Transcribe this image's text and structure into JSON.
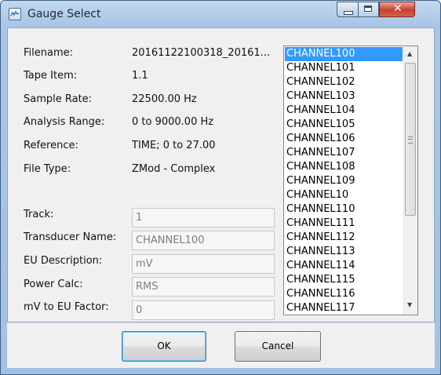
{
  "window": {
    "title": "Gauge Select",
    "close_glyph": "✕"
  },
  "info": {
    "filename_label": "Filename:",
    "filename_value": "20161122100318_20161...",
    "tape_item_label": "Tape Item:",
    "tape_item_value": "1.1",
    "sample_rate_label": "Sample Rate:",
    "sample_rate_value": "22500.00 Hz",
    "analysis_range_label": "Analysis Range:",
    "analysis_range_value": "0 to 9000.00 Hz",
    "reference_label": "Reference:",
    "reference_value": "TIME; 0 to 27.00",
    "file_type_label": "File Type:",
    "file_type_value": "ZMod - Complex"
  },
  "fields": {
    "track_label": "Track:",
    "track_value": "1",
    "transducer_label": "Transducer Name:",
    "transducer_value": "CHANNEL100",
    "eu_desc_label": "EU Description:",
    "eu_desc_value": "mV",
    "power_calc_label": "Power Calc:",
    "power_calc_value": "RMS",
    "factor_label": "mV to EU Factor:",
    "factor_value": "0"
  },
  "channel_list": {
    "selected_index": 0,
    "items": [
      "CHANNEL100",
      "CHANNEL101",
      "CHANNEL102",
      "CHANNEL103",
      "CHANNEL104",
      "CHANNEL105",
      "CHANNEL106",
      "CHANNEL107",
      "CHANNEL108",
      "CHANNEL109",
      "CHANNEL10",
      "CHANNEL110",
      "CHANNEL111",
      "CHANNEL112",
      "CHANNEL113",
      "CHANNEL114",
      "CHANNEL115",
      "CHANNEL116",
      "CHANNEL117"
    ]
  },
  "buttons": {
    "ok_label": "OK",
    "cancel_label": "Cancel"
  },
  "colors": {
    "selection": "#3399ff",
    "titlebar": "#a9c6e6",
    "close_button": "#c7402b"
  },
  "icons": {
    "app": "app-icon",
    "minimize": "minimize-icon",
    "maximize": "maximize-icon",
    "close": "close-icon",
    "scroll_up": "scroll-up-icon",
    "scroll_down": "scroll-down-icon"
  }
}
